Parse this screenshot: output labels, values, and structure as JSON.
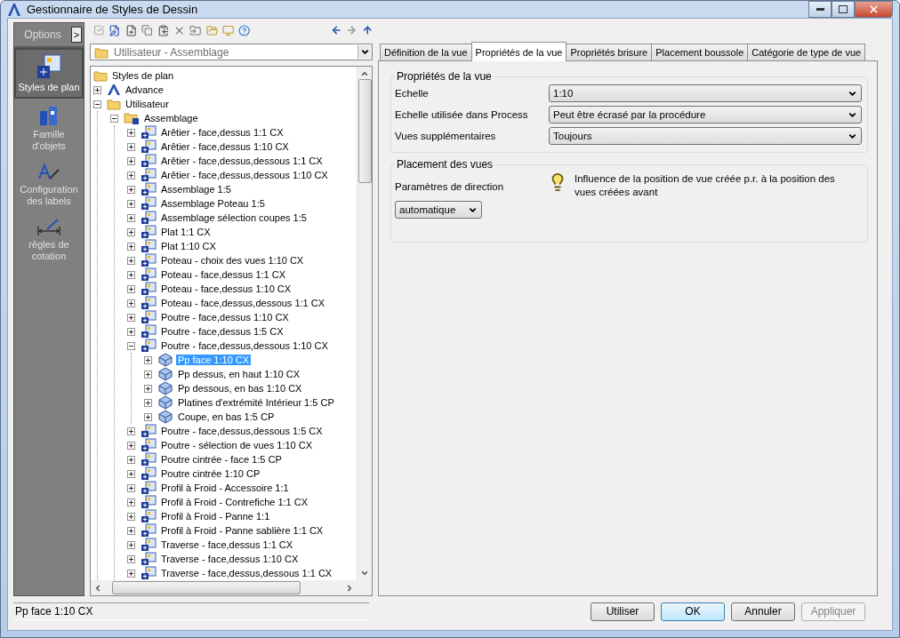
{
  "window": {
    "title": "Gestionnaire de Styles de Dessin"
  },
  "nav": {
    "header": "Options",
    "expand_button": ">",
    "items": [
      {
        "label": "Styles de plan",
        "selected": true,
        "kind": "plan"
      },
      {
        "label": "Famille d'objets",
        "selected": false,
        "kind": "family"
      },
      {
        "label": "Configuration des labels",
        "selected": false,
        "kind": "labels"
      },
      {
        "label": "règles de cotation",
        "selected": false,
        "kind": "dimension"
      }
    ]
  },
  "location_combo": {
    "value": "Utilisateur - Assemblage"
  },
  "tree": {
    "label": "Styles de plan",
    "kind": "folder",
    "children": [
      {
        "label": "Advance",
        "kind": "app",
        "expanded": false,
        "selected": false
      },
      {
        "label": "Utilisateur",
        "kind": "folder",
        "expanded": true,
        "selected": false,
        "children": [
          {
            "label": "Assemblage",
            "kind": "style-folder",
            "expanded": true,
            "selected": false,
            "children": [
              {
                "label": "Arêtier - face,dessus 1:1 CX",
                "kind": "style",
                "expanded": false,
                "selected": false
              },
              {
                "label": "Arêtier - face,dessus 1:10 CX",
                "kind": "style",
                "expanded": false,
                "selected": false
              },
              {
                "label": "Arêtier - face,dessus,dessous 1:1 CX",
                "kind": "style",
                "expanded": false,
                "selected": false
              },
              {
                "label": "Arêtier - face,dessus,dessous 1:10 CX",
                "kind": "style",
                "expanded": false,
                "selected": false
              },
              {
                "label": "Assemblage 1:5",
                "kind": "style",
                "expanded": false,
                "selected": false
              },
              {
                "label": "Assemblage Poteau 1:5",
                "kind": "style",
                "expanded": false,
                "selected": false
              },
              {
                "label": "Assemblage sélection coupes 1:5",
                "kind": "style",
                "expanded": false,
                "selected": false
              },
              {
                "label": "Plat 1:1 CX",
                "kind": "style",
                "expanded": false,
                "selected": false
              },
              {
                "label": "Plat 1:10 CX",
                "kind": "style",
                "expanded": false,
                "selected": false
              },
              {
                "label": "Poteau - choix des vues 1:10 CX",
                "kind": "style",
                "expanded": false,
                "selected": false
              },
              {
                "label": "Poteau - face,dessus 1:1 CX",
                "kind": "style",
                "expanded": false,
                "selected": false
              },
              {
                "label": "Poteau - face,dessus 1:10 CX",
                "kind": "style",
                "expanded": false,
                "selected": false
              },
              {
                "label": "Poteau - face,dessus,dessous 1:1 CX",
                "kind": "style",
                "expanded": false,
                "selected": false
              },
              {
                "label": "Poutre - face,dessus 1:10 CX",
                "kind": "style",
                "expanded": false,
                "selected": false
              },
              {
                "label": "Poutre - face,dessus 1:5 CX",
                "kind": "style",
                "expanded": false,
                "selected": false
              },
              {
                "label": "Poutre - face,dessus,dessous 1:10 CX",
                "kind": "style",
                "expanded": true,
                "selected": false,
                "children": [
                  {
                    "label": "Pp face 1:10 CX",
                    "kind": "view",
                    "expanded": false,
                    "selected": true
                  },
                  {
                    "label": "Pp dessus, en haut 1:10 CX",
                    "kind": "view",
                    "expanded": false,
                    "selected": false
                  },
                  {
                    "label": "Pp dessous, en bas 1:10 CX",
                    "kind": "view",
                    "expanded": false,
                    "selected": false
                  },
                  {
                    "label": "Platines d'extrémité Intérieur 1:5 CP",
                    "kind": "view",
                    "expanded": false,
                    "selected": false
                  },
                  {
                    "label": "Coupe, en bas 1:5 CP",
                    "kind": "view",
                    "expanded": false,
                    "selected": false
                  }
                ]
              },
              {
                "label": "Poutre - face,dessus,dessous 1:5 CX",
                "kind": "style",
                "expanded": false,
                "selected": false
              },
              {
                "label": "Poutre - sélection de vues 1:10 CX",
                "kind": "style",
                "expanded": false,
                "selected": false
              },
              {
                "label": "Poutre cintrée - face 1:5 CP",
                "kind": "style",
                "expanded": false,
                "selected": false
              },
              {
                "label": "Poutre cintrée 1:10 CP",
                "kind": "style",
                "expanded": false,
                "selected": false
              },
              {
                "label": "Profil à Froid - Accessoire 1:1",
                "kind": "style",
                "expanded": false,
                "selected": false
              },
              {
                "label": "Profil à Froid - Contrefiche 1:1 CX",
                "kind": "style",
                "expanded": false,
                "selected": false
              },
              {
                "label": "Profil à Froid - Panne 1:1",
                "kind": "style",
                "expanded": false,
                "selected": false
              },
              {
                "label": "Profil à Froid - Panne sablière 1:1 CX",
                "kind": "style",
                "expanded": false,
                "selected": false
              },
              {
                "label": "Traverse - face,dessus 1:1 CX",
                "kind": "style",
                "expanded": false,
                "selected": false
              },
              {
                "label": "Traverse - face,dessus 1:10 CX",
                "kind": "style",
                "expanded": false,
                "selected": false
              },
              {
                "label": "Traverse - face,dessus,dessous 1:1 CX",
                "kind": "style",
                "expanded": false,
                "selected": false
              }
            ]
          }
        ]
      }
    ]
  },
  "tabs": [
    {
      "label": "Définition de la vue",
      "selected": false
    },
    {
      "label": "Propriétés de la vue",
      "selected": true
    },
    {
      "label": "Propriétés brisure",
      "selected": false
    },
    {
      "label": "Placement boussole",
      "selected": false
    },
    {
      "label": "Catégorie de type de vue",
      "selected": false
    }
  ],
  "view_properties": {
    "title": "Propriétés de la vue",
    "rows": [
      {
        "label": "Echelle",
        "value": "1:10"
      },
      {
        "label": "Echelle utilisée dans Process",
        "value": "Peut être écrasé par la procédure"
      },
      {
        "label": "Vues supplémentaires",
        "value": "Toujours"
      }
    ]
  },
  "view_placement": {
    "title": "Placement des vues",
    "direction_label": "Paramètres de direction",
    "direction_value": "automatique",
    "info": "Influence de la position de vue créée p.r. à la position des vues créées avant"
  },
  "status_bar": {
    "text": "Pp face 1:10 CX"
  },
  "buttons": [
    {
      "label": "Utiliser",
      "kind": "normal",
      "disabled": false
    },
    {
      "label": "OK",
      "kind": "default",
      "disabled": false
    },
    {
      "label": "Annuler",
      "kind": "normal",
      "disabled": false
    },
    {
      "label": "Appliquer",
      "kind": "normal",
      "disabled": true
    }
  ]
}
